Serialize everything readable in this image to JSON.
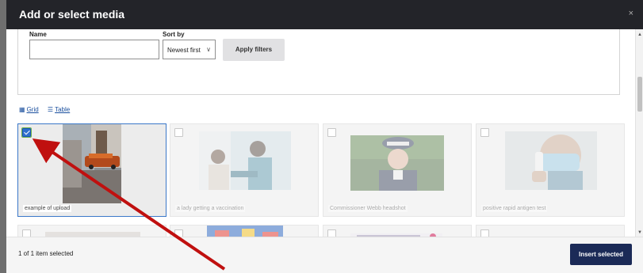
{
  "dialog": {
    "title": "Add or select media",
    "close_label": "×"
  },
  "filters": {
    "name_label": "Name",
    "name_value": "",
    "sort_label": "Sort by",
    "sort_selected": "Newest first",
    "apply_label": "Apply filters"
  },
  "view": {
    "grid_label": "Grid",
    "table_label": "Table"
  },
  "media": [
    {
      "caption": "example of upload",
      "selected": true
    },
    {
      "caption": "a lady getting a vaccination",
      "selected": false
    },
    {
      "caption": "Commissioner Webb headshot",
      "selected": false
    },
    {
      "caption": "positive rapid antigen test",
      "selected": false
    }
  ],
  "footer": {
    "selection_status": "1 of 1 item selected",
    "insert_label": "Insert selected"
  },
  "colors": {
    "titlebar": "#232429",
    "accent": "#1b2a57",
    "selected_border": "#3b78c9",
    "arrow": "#c0100f"
  }
}
